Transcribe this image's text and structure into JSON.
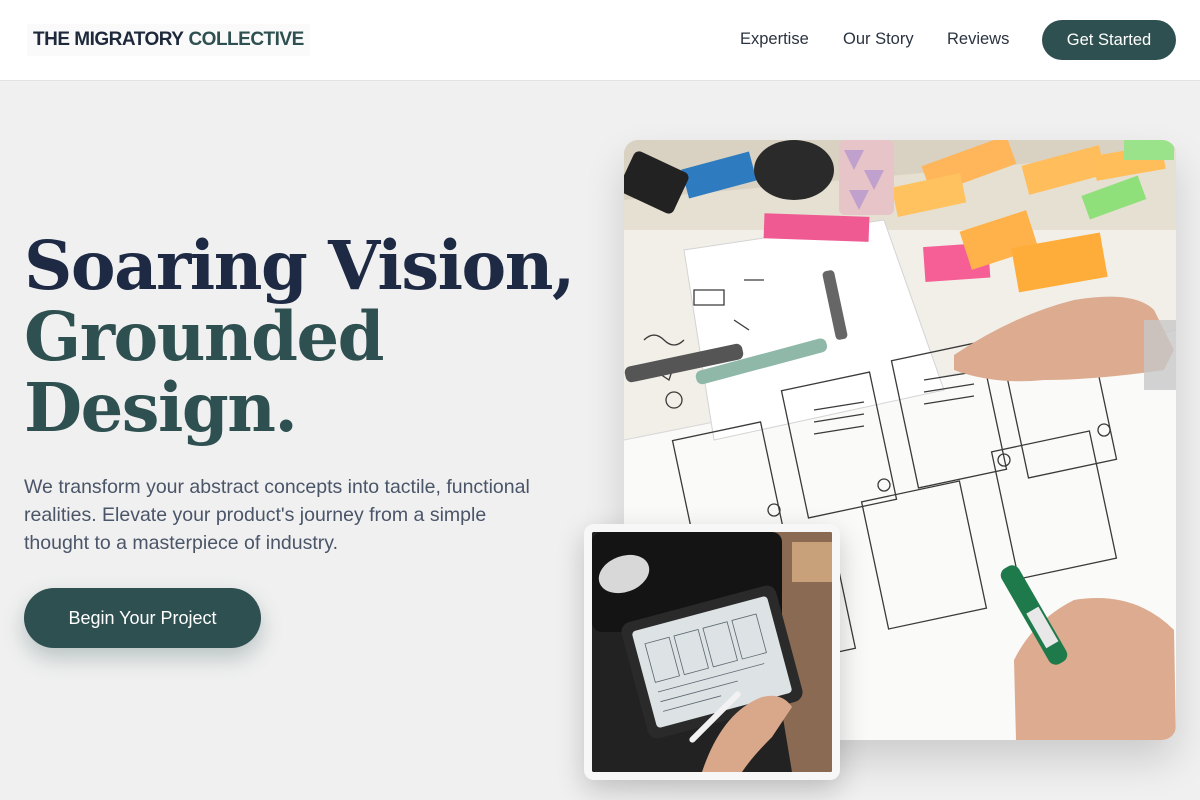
{
  "header": {
    "logo_part1": "THE MIGRATORY",
    "logo_part2": "COLLECTIVE",
    "nav": [
      "Expertise",
      "Our Story",
      "Reviews"
    ],
    "cta_label": "Get Started"
  },
  "hero": {
    "headline_line1": "Soaring Vision,",
    "headline_line2": "Grounded",
    "headline_line3": "Design.",
    "lead": "We transform your abstract concepts into tactile, functional realities. Elevate your product's journey from a simple thought to a masterpiece of industry.",
    "button_label": "Begin Your Project"
  },
  "colors": {
    "accent": "#2f5050",
    "headline_dark": "#1e2a44",
    "background": "#f0f0f0"
  },
  "images": {
    "main": "wireframe-sketching-photo",
    "secondary": "tablet-drawing-photo"
  }
}
